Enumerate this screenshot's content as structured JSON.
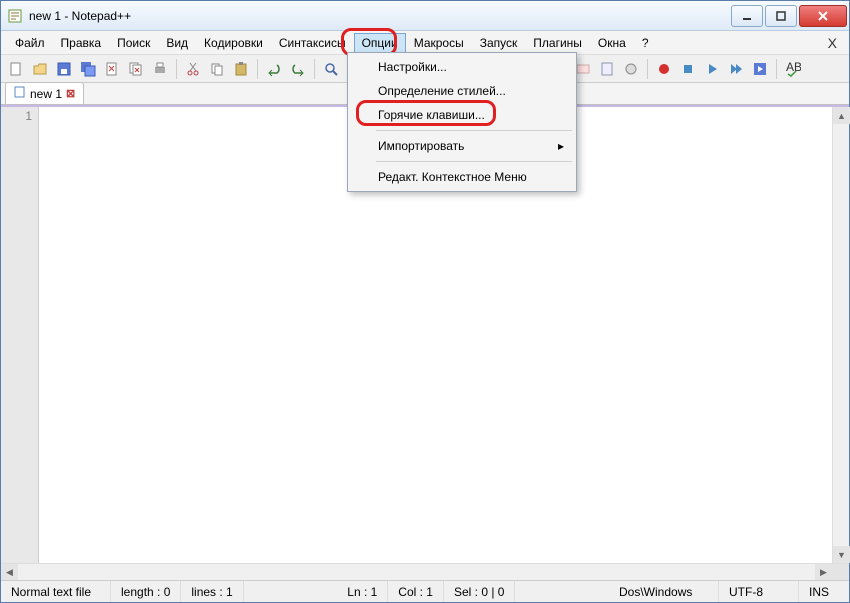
{
  "window": {
    "title": "new 1 - Notepad++"
  },
  "menubar": {
    "items": [
      "Файл",
      "Правка",
      "Поиск",
      "Вид",
      "Кодировки",
      "Синтаксисы",
      "Опции",
      "Макросы",
      "Запуск",
      "Плагины",
      "Окна",
      "?"
    ],
    "close_x": "X",
    "active_index": 6
  },
  "dropdown": {
    "items": [
      {
        "label": "Настройки...",
        "submenu": false
      },
      {
        "label": "Определение стилей...",
        "submenu": false
      },
      {
        "label": "Горячие клавиши...",
        "submenu": false,
        "highlighted": true
      },
      {
        "sep": true
      },
      {
        "label": "Импортировать",
        "submenu": true
      },
      {
        "sep": true
      },
      {
        "label": "Редакт. Контекстное Меню",
        "submenu": false
      }
    ]
  },
  "tabs": [
    {
      "label": "new 1"
    }
  ],
  "gutter": {
    "line1": "1"
  },
  "statusbar": {
    "filetype": "Normal text file",
    "length": "length : 0",
    "lines": "lines : 1",
    "ln": "Ln : 1",
    "col": "Col : 1",
    "sel": "Sel : 0 | 0",
    "eol": "Dos\\Windows",
    "encoding": "UTF-8",
    "mode": "INS"
  },
  "toolbar_icons": [
    "new",
    "open",
    "save",
    "save-all",
    "close",
    "close-all",
    "print",
    "sep",
    "cut",
    "copy",
    "paste",
    "sep",
    "undo",
    "redo",
    "sep",
    "find",
    "replace",
    "sep",
    "zoom-in",
    "zoom-out",
    "sep",
    "sync-v",
    "sync-h",
    "sep",
    "wordwrap",
    "all-chars",
    "indent-guide",
    "sep",
    "lang",
    "monitor",
    "sep",
    "record",
    "stop",
    "play",
    "play-multi",
    "save-macro",
    "sep",
    "spellcheck"
  ]
}
